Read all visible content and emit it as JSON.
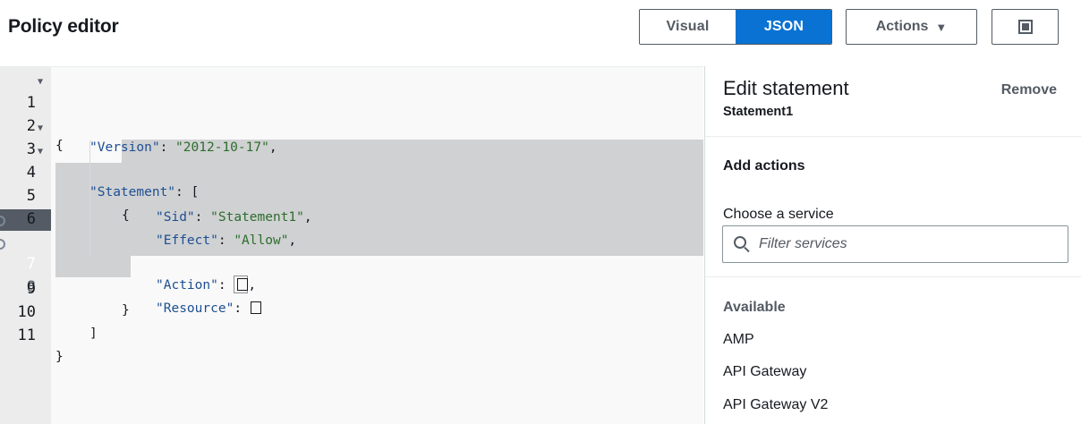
{
  "header": {
    "title": "Policy editor",
    "visual_label": "Visual",
    "json_label": "JSON",
    "actions_label": "Actions",
    "actions_caret": "▼"
  },
  "editor": {
    "lines": [
      {
        "n": "1",
        "fold": "▼"
      },
      {
        "n": "2"
      },
      {
        "n": "3",
        "fold": "▼"
      },
      {
        "n": "4",
        "fold": "▼"
      },
      {
        "n": "5"
      },
      {
        "n": "6"
      },
      {
        "n": "7",
        "active": true
      },
      {
        "n": "8"
      },
      {
        "n": "9"
      },
      {
        "n": "10"
      },
      {
        "n": "11"
      }
    ],
    "tokens": {
      "open_brace": "{",
      "version_key": "\"Version\"",
      "version_val": "\"2012-10-17\"",
      "statement_key": "\"Statement\"",
      "open_bracket": "[",
      "stmt_open": "{",
      "sid_key": "\"Sid\"",
      "sid_val": "\"Statement1\"",
      "effect_key": "\"Effect\"",
      "effect_val": "\"Allow\"",
      "action_key": "\"Action\"",
      "resource_key": "\"Resource\"",
      "stmt_close": "}",
      "close_bracket": "]",
      "close_brace": "}",
      "colon": ": ",
      "comma": ","
    }
  },
  "panel": {
    "title": "Edit statement",
    "subtitle": "Statement1",
    "remove_label": "Remove",
    "add_actions": "Add actions",
    "choose_service": "Choose a service",
    "filter_placeholder": "Filter services",
    "available_label": "Available",
    "services": [
      "AMP",
      "API Gateway",
      "API Gateway V2"
    ]
  }
}
